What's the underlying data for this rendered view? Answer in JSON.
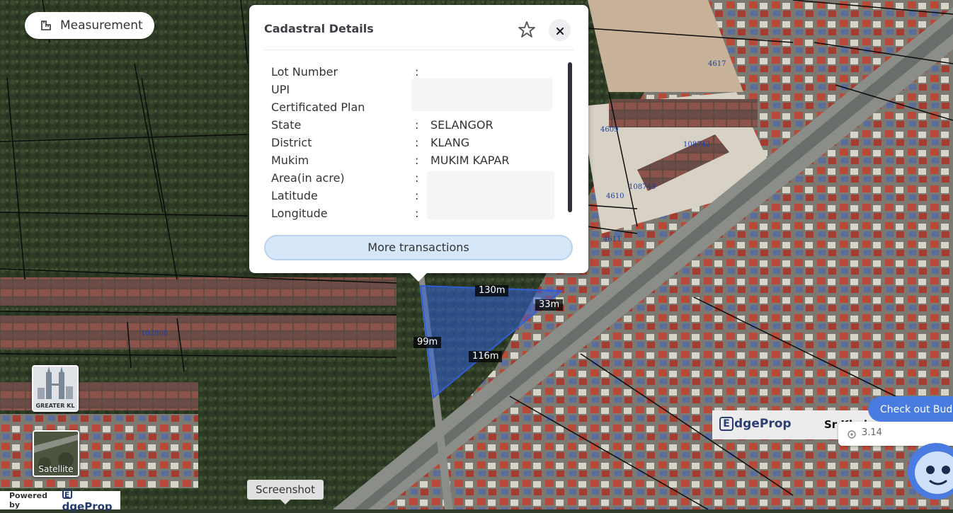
{
  "map": {
    "lot_labels": [
      "4609",
      "4610",
      "4611",
      "108742",
      "108743",
      "102808",
      "4617"
    ],
    "dimensions": [
      "130m",
      "33m",
      "99m",
      "116m"
    ]
  },
  "measurement": {
    "label": "Measurement",
    "icon": "measure-icon"
  },
  "popup": {
    "title": "Cadastral Details",
    "rows": [
      {
        "label": "Lot Number",
        "colon": ":",
        "value": ""
      },
      {
        "label": "UPI",
        "colon": "",
        "value": ""
      },
      {
        "label": "Certificated Plan",
        "colon": "",
        "value": ""
      },
      {
        "label": "State",
        "colon": ":",
        "value": "SELANGOR"
      },
      {
        "label": "District",
        "colon": ":",
        "value": "KLANG"
      },
      {
        "label": "Mukim",
        "colon": ":",
        "value": "MUKIM KAPAR"
      },
      {
        "label": "Area(in acre)",
        "colon": ":",
        "value": ""
      },
      {
        "label": "Latitude",
        "colon": ":",
        "value": ""
      },
      {
        "label": "Longitude",
        "colon": ":",
        "value": ""
      }
    ],
    "more_label": "More transactions"
  },
  "controls": {
    "greater_kl": "GREATER KL",
    "satellite": "Satellite"
  },
  "powered": {
    "prefix": "Powered by",
    "brand_e": "E",
    "brand_rest": "dgeProp"
  },
  "screenshot_label": "Screenshot",
  "banner": {
    "brand_e": "E",
    "brand_rest": "dgeProp",
    "agent": "Sr Khairulnawawi MRISM"
  },
  "chat": {
    "bubble": "Check out Budd",
    "score": "3.14"
  },
  "colors": {
    "accent_blue": "#2f5fd6",
    "button_blue": "#d6e7fa",
    "brand_navy": "#2a3f73"
  }
}
